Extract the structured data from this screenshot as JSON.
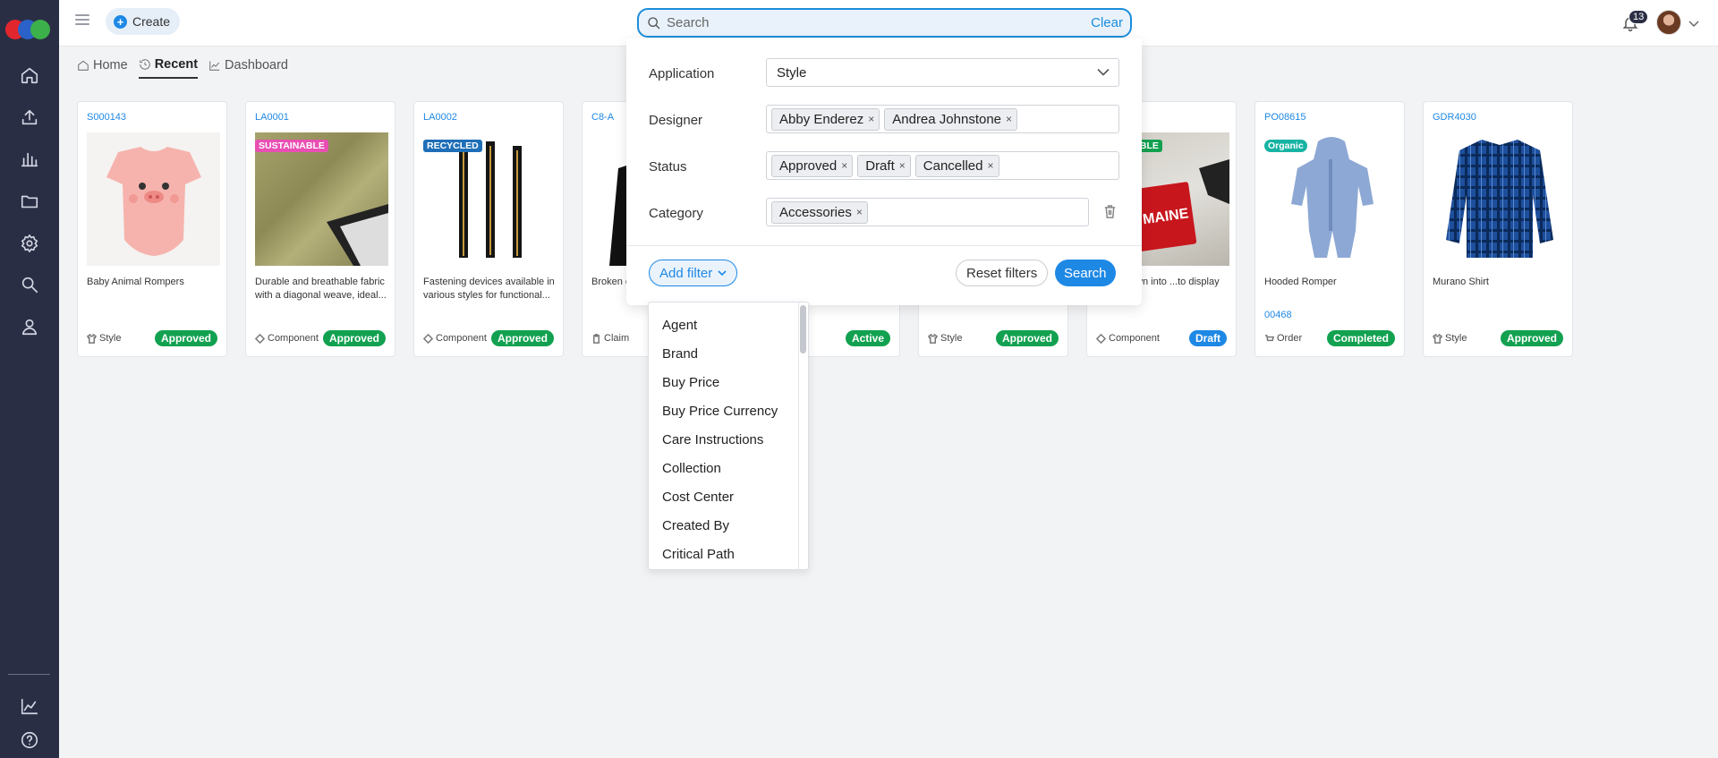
{
  "topbar": {
    "create_label": "Create",
    "search_placeholder": "Search",
    "clear_label": "Clear",
    "notification_count": "13"
  },
  "nav": [
    {
      "label": "Home",
      "icon": "home-icon"
    },
    {
      "label": "Recent",
      "icon": "history-icon"
    },
    {
      "label": "Dashboard",
      "icon": "chart-line-icon"
    }
  ],
  "cards": [
    {
      "code": "S000143",
      "tag": "",
      "desc": "Baby Animal Rompers",
      "ref": "",
      "type": "Style",
      "status": "Approved"
    },
    {
      "code": "LA0001",
      "tag": "SUSTAINABLE",
      "desc": "Durable and breathable fabric with a diagonal weave, ideal...",
      "ref": "",
      "type": "Component",
      "status": "Approved"
    },
    {
      "code": "LA0002",
      "tag": "RECYCLED",
      "desc": "Fastening devices available in various styles for functional...",
      "ref": "",
      "type": "Component",
      "status": "Approved"
    },
    {
      "code": "C8-A",
      "tag": "",
      "desc": "Broken c... press re...",
      "ref": "",
      "type": "Claim",
      "status": ""
    },
    {
      "code": "",
      "tag": "",
      "desc": "",
      "ref": "",
      "type": "",
      "status": "Active"
    },
    {
      "code": "",
      "tag": "",
      "desc": "",
      "ref": "",
      "type": "Style",
      "status": "Approved"
    },
    {
      "code": "",
      "tag": "IBLE",
      "desc": "...bels sewn into ...to display brand...",
      "ref": "",
      "type": "Component",
      "status": "Draft"
    },
    {
      "code": "PO08615",
      "tag": "Organic",
      "desc": "Hooded Romper",
      "ref": "00468",
      "type": "Order",
      "status": "Completed"
    },
    {
      "code": "GDR4030",
      "tag": "",
      "desc": "Murano Shirt",
      "ref": "",
      "type": "Style",
      "status": "Approved"
    }
  ],
  "filters": {
    "application_label": "Application",
    "application_value": "Style",
    "designer_label": "Designer",
    "designers": [
      "Abby  Enderez",
      "Andrea Johnstone"
    ],
    "status_label": "Status",
    "statuses": [
      "Approved",
      "Draft",
      "Cancelled"
    ],
    "category_label": "Category",
    "categories": [
      "Accessories"
    ],
    "add_filter_label": "Add filter",
    "reset_label": "Reset filters",
    "search_label": "Search"
  },
  "filter_options": [
    "Agent",
    "Brand",
    "Buy Price",
    "Buy Price Currency",
    "Care Instructions",
    "Collection",
    "Cost Center",
    "Created By",
    "Critical Path"
  ],
  "chip_remove": "×",
  "image_text": {
    "maine_label": "MAINE"
  },
  "colors": {
    "accent": "#1e88e5",
    "approved": "#12a150",
    "sidebar": "#2a2e45"
  }
}
